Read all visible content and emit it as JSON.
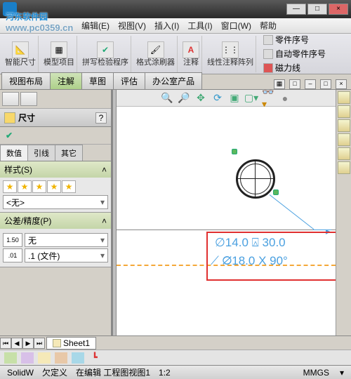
{
  "window": {
    "minimize": "—",
    "maximize": "□",
    "close": "×"
  },
  "watermark": {
    "line1": "河东软件园",
    "line2": "www.pc0359.cn"
  },
  "menu": {
    "edit": "编辑(E)",
    "view": "视图(V)",
    "insert": "插入(I)",
    "tools": "工具(I)",
    "window": "窗口(W)",
    "help": "帮助"
  },
  "ribbon": {
    "smartdim": "智能尺寸",
    "modelitems": "模型项目",
    "spellcheck": "拼写检验程序",
    "formatpaint": "格式涂刷器",
    "note": "注释",
    "linearpat": "线性注释阵列",
    "balloon": "零件序号",
    "autoballoon": "自动零件序号",
    "magline": "磁力线"
  },
  "tabs": {
    "layout": "视图布局",
    "annot": "注解",
    "sketch": "草图",
    "eval": "评估",
    "office": "办公室产品"
  },
  "panel": {
    "dimension": "尺寸",
    "help": "?",
    "ptabs": {
      "value": "数值",
      "leader": "引线",
      "other": "其它"
    },
    "style": "样式(S)",
    "none": "<无>",
    "tol": "公差/精度(P)",
    "tolnone": "无",
    "tolfile": ".1 (文件)"
  },
  "sheet": {
    "name": "Sheet1"
  },
  "status": {
    "app": "SolidW",
    "underdef": "欠定义",
    "editing": "在编辑 工程图视图1",
    "ratio": "1:2",
    "units": "MMGS"
  },
  "annot_text": {
    "l1": "∅14.0 ⍓ 30.0",
    "l2": "⟋ ∅18.0 X 90°"
  },
  "chart_data": null
}
